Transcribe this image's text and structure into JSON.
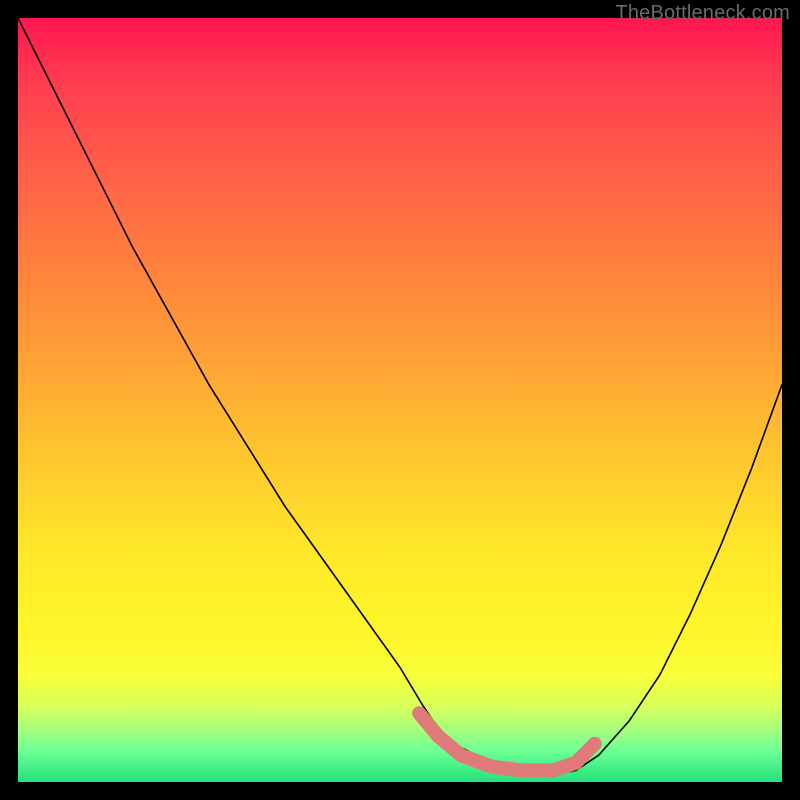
{
  "watermark": "TheBottleneck.com",
  "chart_data": {
    "type": "line",
    "title": "",
    "xlabel": "",
    "ylabel": "",
    "xlim": [
      0,
      1
    ],
    "ylim": [
      0,
      1
    ],
    "series": [
      {
        "name": "curve",
        "x": [
          0.0,
          0.05,
          0.1,
          0.15,
          0.2,
          0.25,
          0.3,
          0.35,
          0.4,
          0.45,
          0.5,
          0.53,
          0.55,
          0.58,
          0.62,
          0.66,
          0.7,
          0.73,
          0.76,
          0.8,
          0.84,
          0.88,
          0.92,
          0.96,
          1.0
        ],
        "values": [
          1.0,
          0.9,
          0.8,
          0.7,
          0.61,
          0.52,
          0.44,
          0.36,
          0.29,
          0.22,
          0.15,
          0.1,
          0.07,
          0.045,
          0.025,
          0.015,
          0.01,
          0.015,
          0.035,
          0.08,
          0.14,
          0.22,
          0.31,
          0.41,
          0.52
        ]
      },
      {
        "name": "bottom-marker-stroke",
        "x": [
          0.525,
          0.55,
          0.58,
          0.62,
          0.66,
          0.7,
          0.73,
          0.755
        ],
        "values": [
          0.09,
          0.06,
          0.035,
          0.02,
          0.015,
          0.015,
          0.025,
          0.05
        ]
      }
    ],
    "colors": {
      "gradient_top": "#ff1650",
      "gradient_mid": "#ffe82a",
      "gradient_bottom": "#22e27a",
      "curve": "#000000",
      "marker": "#e07a7a"
    }
  }
}
